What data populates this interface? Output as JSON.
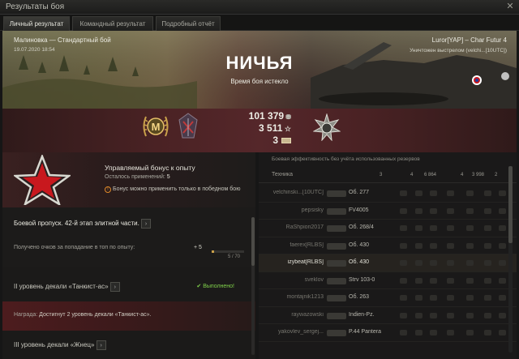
{
  "window": {
    "title": "Результаты боя"
  },
  "tabs": [
    "Личный результат",
    "Командный результат",
    "Подробный отчёт"
  ],
  "battle": {
    "map_mode": "Малиновка — Стандартный бой",
    "datetime": "19.07.2020 18:54",
    "result": "НИЧЬЯ",
    "reason": "Время боя истекло",
    "player_tank": "Luror[YAP] – Char Futur 4",
    "killed_by": "Уничтожен выстрелом (velchi...[10UTC])"
  },
  "rewards": {
    "credits": "101 379",
    "xp": "3 511",
    "crystals": "3"
  },
  "bonus": {
    "title": "Управляемый бонус к опыту",
    "remaining_label": "Осталось применений:",
    "remaining_value": "5",
    "warning": "Бонус можно применить только в победном бою"
  },
  "battlepass": {
    "title": "Боевой пропуск. 42-й этап элитной части.",
    "points_label": "Получено очков за попадание в топ по опыту:",
    "points_value": "+ 5",
    "progress_text": "5 / 70",
    "progress_fraction": 0.071
  },
  "decal2": {
    "title": "II уровень декали «Танкист-ас»",
    "status": "Выполнено!"
  },
  "reward": {
    "label": "Награда:",
    "text": "Достигнут 2 уровень декали «Танкист-ас»."
  },
  "decal3": {
    "title": "III уровень декали «Жнец»"
  },
  "team": {
    "header": "Боевая эффективность без учёта использованных резервов",
    "column": "Техника",
    "col_values": [
      "3",
      "4",
      "6 864",
      "4",
      "3 998",
      "2"
    ],
    "players": [
      {
        "name": "velchinski...[10UTC]",
        "tank": "Об. 277"
      },
      {
        "name": "pepsisky",
        "tank": "FV4005"
      },
      {
        "name": "RaShpion2017",
        "tank": "Об. 268/4"
      },
      {
        "name": "faerex[RLBS]",
        "tank": "Об. 430"
      },
      {
        "name": "izybeat[RLBS]",
        "tank": "Об. 430"
      },
      {
        "name": "sveklov",
        "tank": "Strv 103-0"
      },
      {
        "name": "montajnik1213",
        "tank": "Об. 263"
      },
      {
        "name": "raywazowski",
        "tank": "Indien-Pz."
      },
      {
        "name": "yakovlev_sergej...",
        "tank": "P.44 Pantera"
      }
    ]
  },
  "colors": {
    "accent_gold": "#e8c06a",
    "green_done": "#7fd04a",
    "red_band": "#55272a",
    "star_red": "#c8181e"
  }
}
